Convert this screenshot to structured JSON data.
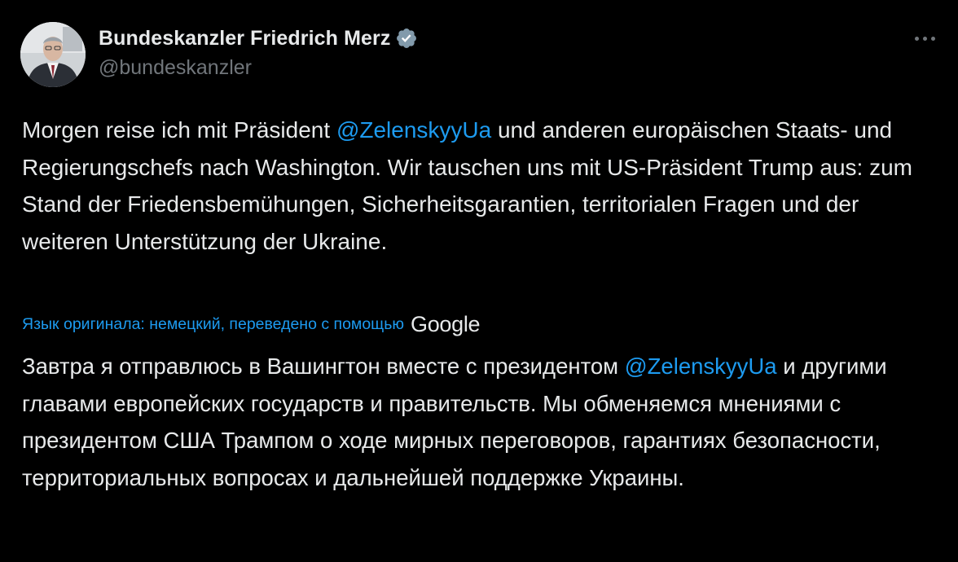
{
  "author": {
    "display_name": "Bundeskanzler Friedrich Merz",
    "handle": "@bundeskanzler",
    "verified_badge_color": "#829aab"
  },
  "menu": {
    "icon": "more-horizontal-icon"
  },
  "tweet": {
    "original": {
      "part1": "Morgen reise ich mit Präsident ",
      "mention": "@ZelenskyyUa",
      "part2": " und anderen europäischen Staats- und Regierungschefs nach Washington. Wir tauschen uns mit US-Präsident Trump aus: zum Stand der Friedensbemühungen, Sicherheitsgarantien, territorialen Fragen und der weiteren Unterstützung der Ukraine."
    },
    "translation_notice": "Язык оригинала: немецкий, переведено с помощью",
    "translation_provider": "Google",
    "translated": {
      "part1": "Завтра я отправлюсь в Вашингтон вместе с президентом ",
      "mention": "@ZelenskyyUa",
      "part2": " и другими главами европейских государств и правительств. Мы обменяемся мнениями с президентом США Трампом о ходе мирных переговоров, гарантиях безопасности, территориальных вопросах и дальнейшей поддержке Украины."
    }
  },
  "colors": {
    "background": "#000000",
    "text": "#e7e9ea",
    "secondary": "#71767b",
    "link": "#1d9bf0"
  }
}
